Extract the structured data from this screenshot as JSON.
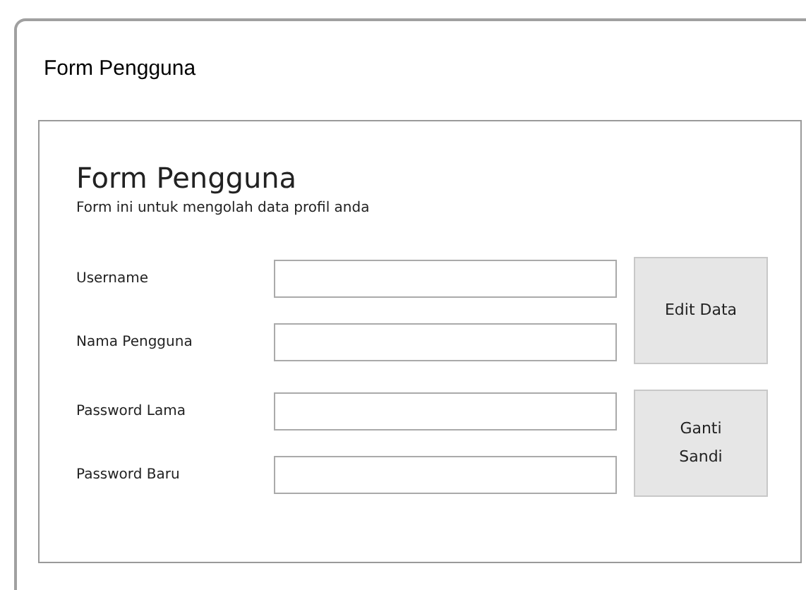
{
  "panel_title": "Form Pengguna",
  "form": {
    "heading": "Form Pengguna",
    "subtitle": "Form ini untuk mengolah data profil anda",
    "groups": [
      {
        "fields": [
          {
            "label": "Username"
          },
          {
            "label": "Nama Pengguna"
          }
        ],
        "button": "Edit Data"
      },
      {
        "fields": [
          {
            "label": "Password Lama"
          },
          {
            "label": "Password Baru"
          }
        ],
        "button": "Ganti\nSandi"
      }
    ]
  }
}
